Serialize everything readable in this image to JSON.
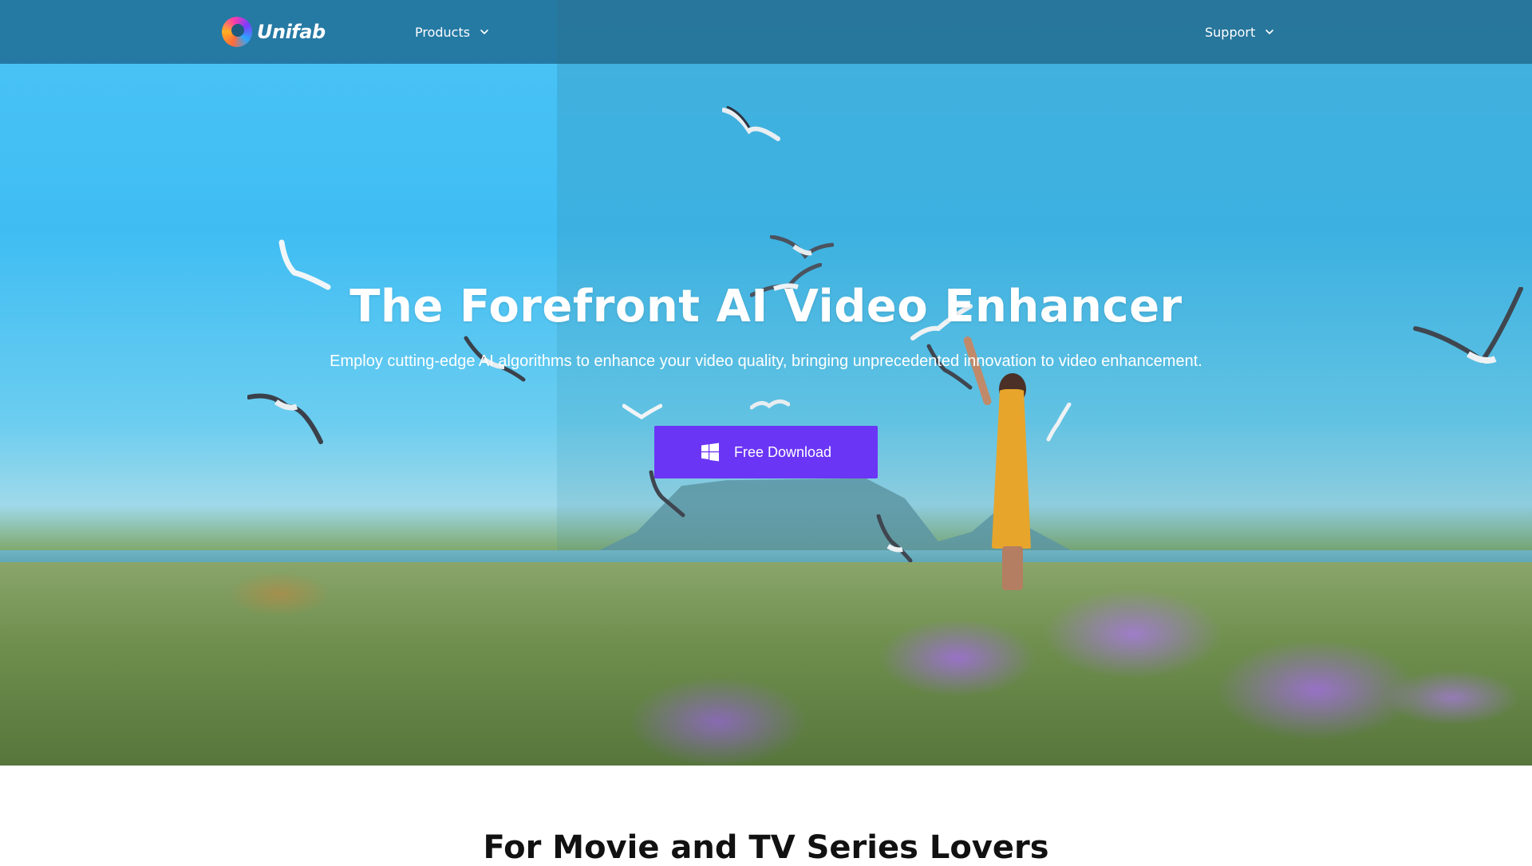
{
  "brand": {
    "name": "Unifab",
    "accent": "#6a35f5"
  },
  "nav": {
    "products_label": "Products",
    "support_label": "Support"
  },
  "hero": {
    "title": "The Forefront AI Video Enhancer",
    "subtitle": "Employ cutting-edge AI algorithms to enhance your video quality, bringing unprecedented innovation to video enhancement.",
    "cta_label": "Free Download",
    "cta_icon": "windows-icon"
  },
  "section": {
    "title": "For Movie and TV Series Lovers"
  }
}
